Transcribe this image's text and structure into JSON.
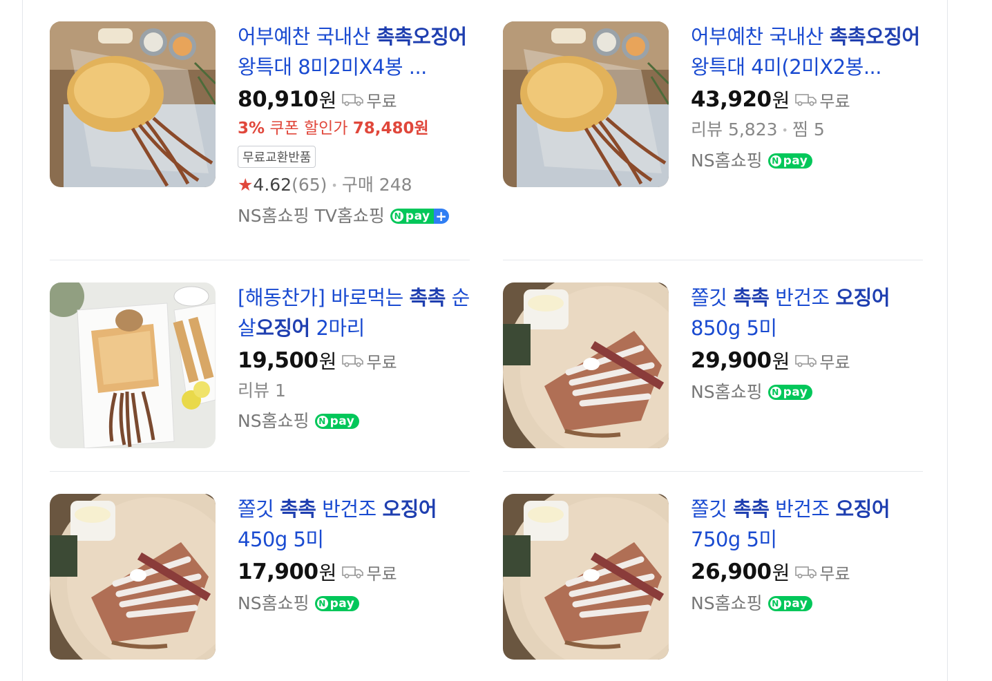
{
  "products": [
    {
      "title_parts": [
        {
          "text": "어부예찬 국내산 ",
          "bold": false
        },
        {
          "text": "촉촉오징어",
          "bold": true
        },
        {
          "text": " 왕특대 8미2미X4봉 ...",
          "bold": false
        }
      ],
      "price": "80,910",
      "won": "원",
      "shipping": "무료",
      "coupon": {
        "percent": "3%",
        "label": " 쿠폰 할인가 ",
        "price": "78,480원"
      },
      "tag": "무료교환반품",
      "rating": "4.62",
      "rating_count": "(65)",
      "purchase": "구매 248",
      "sellers": "NS홈쇼핑 TV홈쇼핑",
      "npay": "pay",
      "npay_plus": true,
      "image": "dried-squid-platter"
    },
    {
      "title_parts": [
        {
          "text": "어부예찬 국내산 ",
          "bold": false
        },
        {
          "text": "촉촉오징어",
          "bold": true
        },
        {
          "text": " 왕특대 4미(2미X2봉...",
          "bold": false
        }
      ],
      "price": "43,920",
      "won": "원",
      "shipping": "무료",
      "review": "리뷰 5,823",
      "wish": "찜 5",
      "sellers": "NS홈쇼핑",
      "npay": "pay",
      "image": "dried-squid-platter"
    },
    {
      "title_parts": [
        {
          "text": "[해동찬가] 바로먹는 ",
          "bold": false
        },
        {
          "text": "촉촉",
          "bold": true
        },
        {
          "text": " 순살",
          "bold": false
        },
        {
          "text": "오징어",
          "bold": true
        },
        {
          "text": " 2마리",
          "bold": false
        }
      ],
      "price": "19,500",
      "won": "원",
      "shipping": "무료",
      "review": "리뷰 1",
      "sellers": "NS홈쇼핑",
      "npay": "pay",
      "image": "squid-on-plate"
    },
    {
      "title_parts": [
        {
          "text": "쫄깃 ",
          "bold": false
        },
        {
          "text": "촉촉",
          "bold": true
        },
        {
          "text": " 반건조 ",
          "bold": false
        },
        {
          "text": "오징어",
          "bold": true
        },
        {
          "text": " 850g 5미",
          "bold": false
        }
      ],
      "price": "29,900",
      "won": "원",
      "shipping": "무료",
      "sellers": "NS홈쇼핑",
      "npay": "pay",
      "image": "semi-dried-squid"
    },
    {
      "title_parts": [
        {
          "text": "쫄깃 ",
          "bold": false
        },
        {
          "text": "촉촉",
          "bold": true
        },
        {
          "text": " 반건조 ",
          "bold": false
        },
        {
          "text": "오징어",
          "bold": true
        },
        {
          "text": " 450g 5미",
          "bold": false
        }
      ],
      "price": "17,900",
      "won": "원",
      "shipping": "무료",
      "sellers": "NS홈쇼핑",
      "npay": "pay",
      "image": "semi-dried-squid"
    },
    {
      "title_parts": [
        {
          "text": "쫄깃 ",
          "bold": false
        },
        {
          "text": "촉촉",
          "bold": true
        },
        {
          "text": " 반건조 ",
          "bold": false
        },
        {
          "text": "오징어",
          "bold": true
        },
        {
          "text": " 750g 5미",
          "bold": false
        }
      ],
      "price": "26,900",
      "won": "원",
      "shipping": "무료",
      "sellers": "NS홈쇼핑",
      "npay": "pay",
      "image": "semi-dried-squid"
    }
  ],
  "colors": {
    "title": "#1a4bd1",
    "coupon": "#e0473b",
    "npay": "#03c75a",
    "npay_plus": "#2f7ef3"
  }
}
